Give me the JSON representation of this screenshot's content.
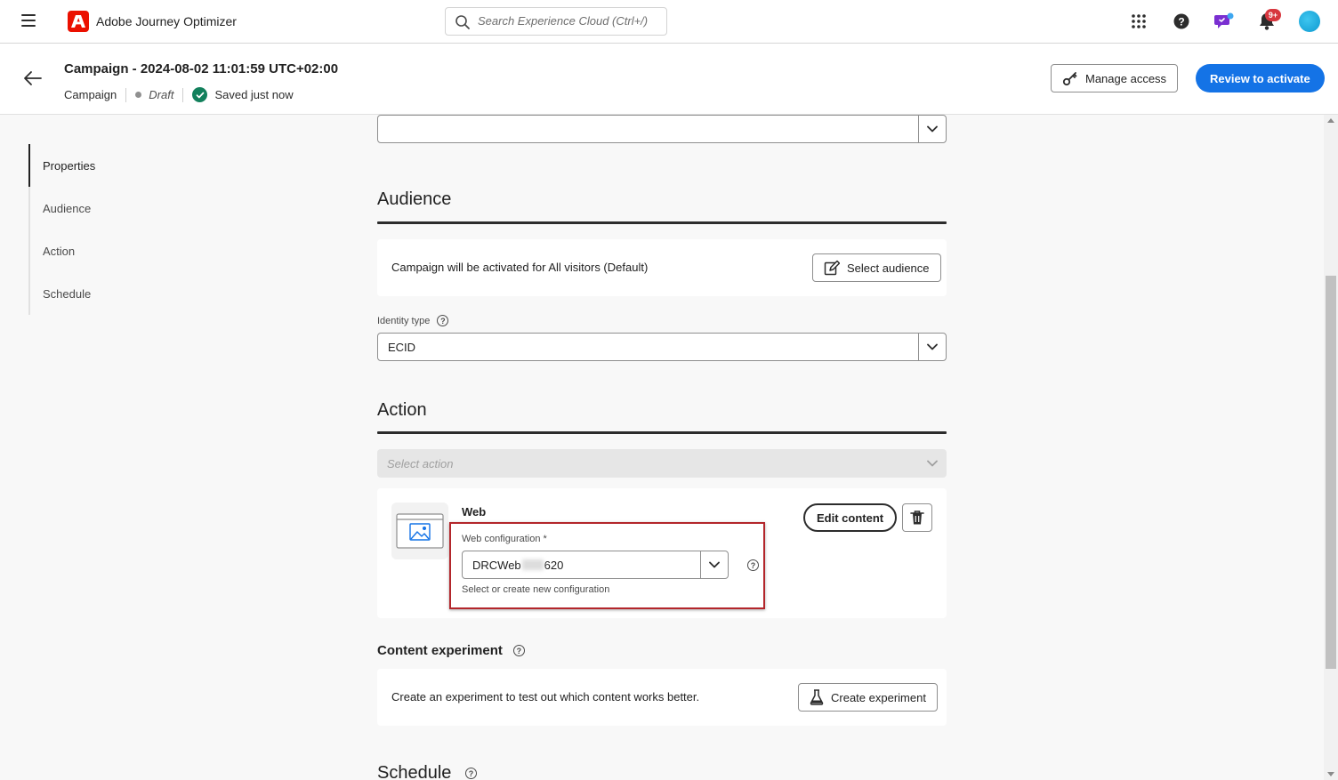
{
  "app": {
    "name": "Adobe Journey Optimizer"
  },
  "search": {
    "placeholder": "Search Experience Cloud (Ctrl+/)"
  },
  "notifications": {
    "badge": "9+"
  },
  "header": {
    "title": "Campaign - 2024-08-02 11:01:59 UTC+02:00",
    "type": "Campaign",
    "status": "Draft",
    "saved": "Saved just now",
    "manage_access": "Manage access",
    "review": "Review to activate"
  },
  "nav": {
    "items": [
      {
        "label": "Properties"
      },
      {
        "label": "Audience"
      },
      {
        "label": "Action"
      },
      {
        "label": "Schedule"
      }
    ]
  },
  "audience": {
    "title": "Audience",
    "info": "Campaign will be activated for All visitors (Default)",
    "select_button": "Select audience",
    "identity_label": "Identity type",
    "identity_value": "ECID"
  },
  "action": {
    "title": "Action",
    "select_placeholder": "Select action",
    "channel": "Web",
    "web_config_label": "Web configuration",
    "required_mark": "*",
    "web_config_prefix": "DRCWeb",
    "web_config_suffix": "620",
    "web_config_hint": "Select or create new configuration",
    "edit_content": "Edit content"
  },
  "experiment": {
    "title": "Content experiment",
    "info": "Create an experiment to test out which content works better.",
    "button": "Create experiment"
  },
  "schedule": {
    "title": "Schedule"
  },
  "colors": {
    "accent": "#1473e6",
    "highlight": "#b3262b",
    "brand": "#eb1000",
    "success": "#12805c",
    "badge": "#d7373f"
  }
}
